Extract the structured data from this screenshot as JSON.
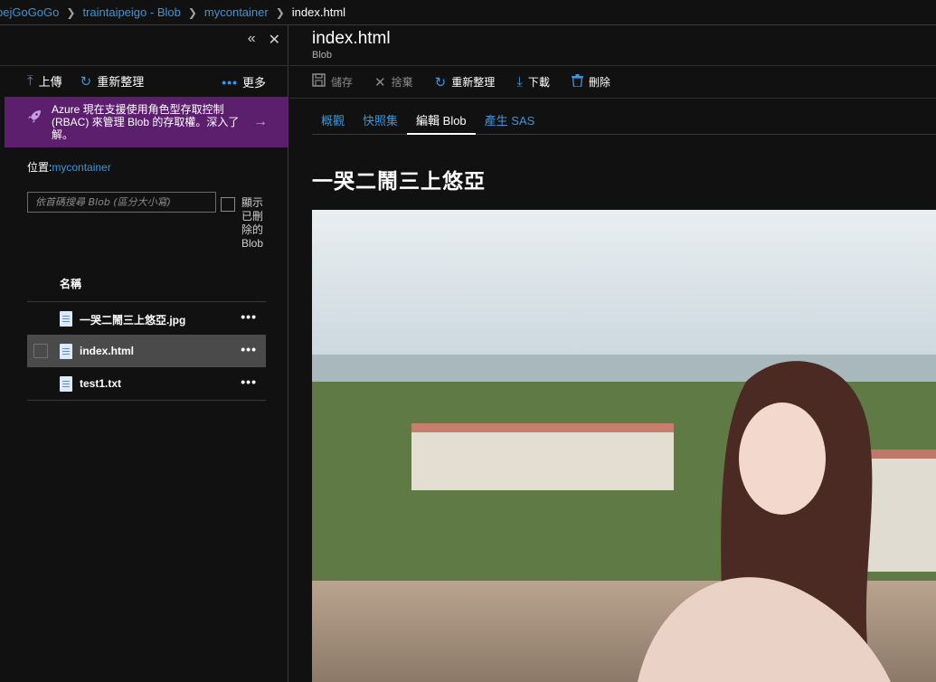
{
  "breadcrumb": {
    "items": [
      "pejGoGoGo",
      "traintaipeigo - Blob",
      "mycontainer"
    ],
    "current": "index.html"
  },
  "left_pane": {
    "controls": {
      "collapse": "«",
      "close": "✕"
    },
    "toolbar": {
      "upload": "上傳",
      "refresh": "重新整理",
      "more": "更多"
    },
    "banner": {
      "text": "Azure 現在支援使用角色型存取控制 (RBAC) 來管理 Blob 的存取權。深入了解。"
    },
    "location": {
      "label": "位置:",
      "value": "mycontainer"
    },
    "search": {
      "placeholder": "依首碼搜尋 Blob (區分大小寫)",
      "value": ""
    },
    "show_deleted_label": "顯示已刪除的Blob",
    "list_header": "名稱",
    "files": [
      {
        "name": "一哭二鬧三上悠亞.jpg",
        "selected": false
      },
      {
        "name": "index.html",
        "selected": true
      },
      {
        "name": "test1.txt",
        "selected": false
      }
    ]
  },
  "right_pane": {
    "title": "index.html",
    "subtitle": "Blob",
    "toolbar": {
      "save": "儲存",
      "discard": "捨棄",
      "refresh": "重新整理",
      "download": "下載",
      "delete": "刪除"
    },
    "tabs": [
      "概觀",
      "快照集",
      "編輯 Blob",
      "產生 SAS"
    ],
    "active_tab": "編輯 Blob",
    "content_heading": "一哭二鬧三上悠亞"
  },
  "colors": {
    "background": "#111111",
    "accent": "#3a96dd",
    "banner": "#5c1f6e",
    "selected_row": "#4a4a4a"
  },
  "icons": [
    "chevron-right-icon",
    "double-chevron-left-icon",
    "close-icon",
    "upload-icon",
    "refresh-icon",
    "more-icon",
    "rocket-icon",
    "arrow-right-icon",
    "file-icon",
    "save-icon",
    "discard-icon",
    "download-icon",
    "delete-icon"
  ]
}
